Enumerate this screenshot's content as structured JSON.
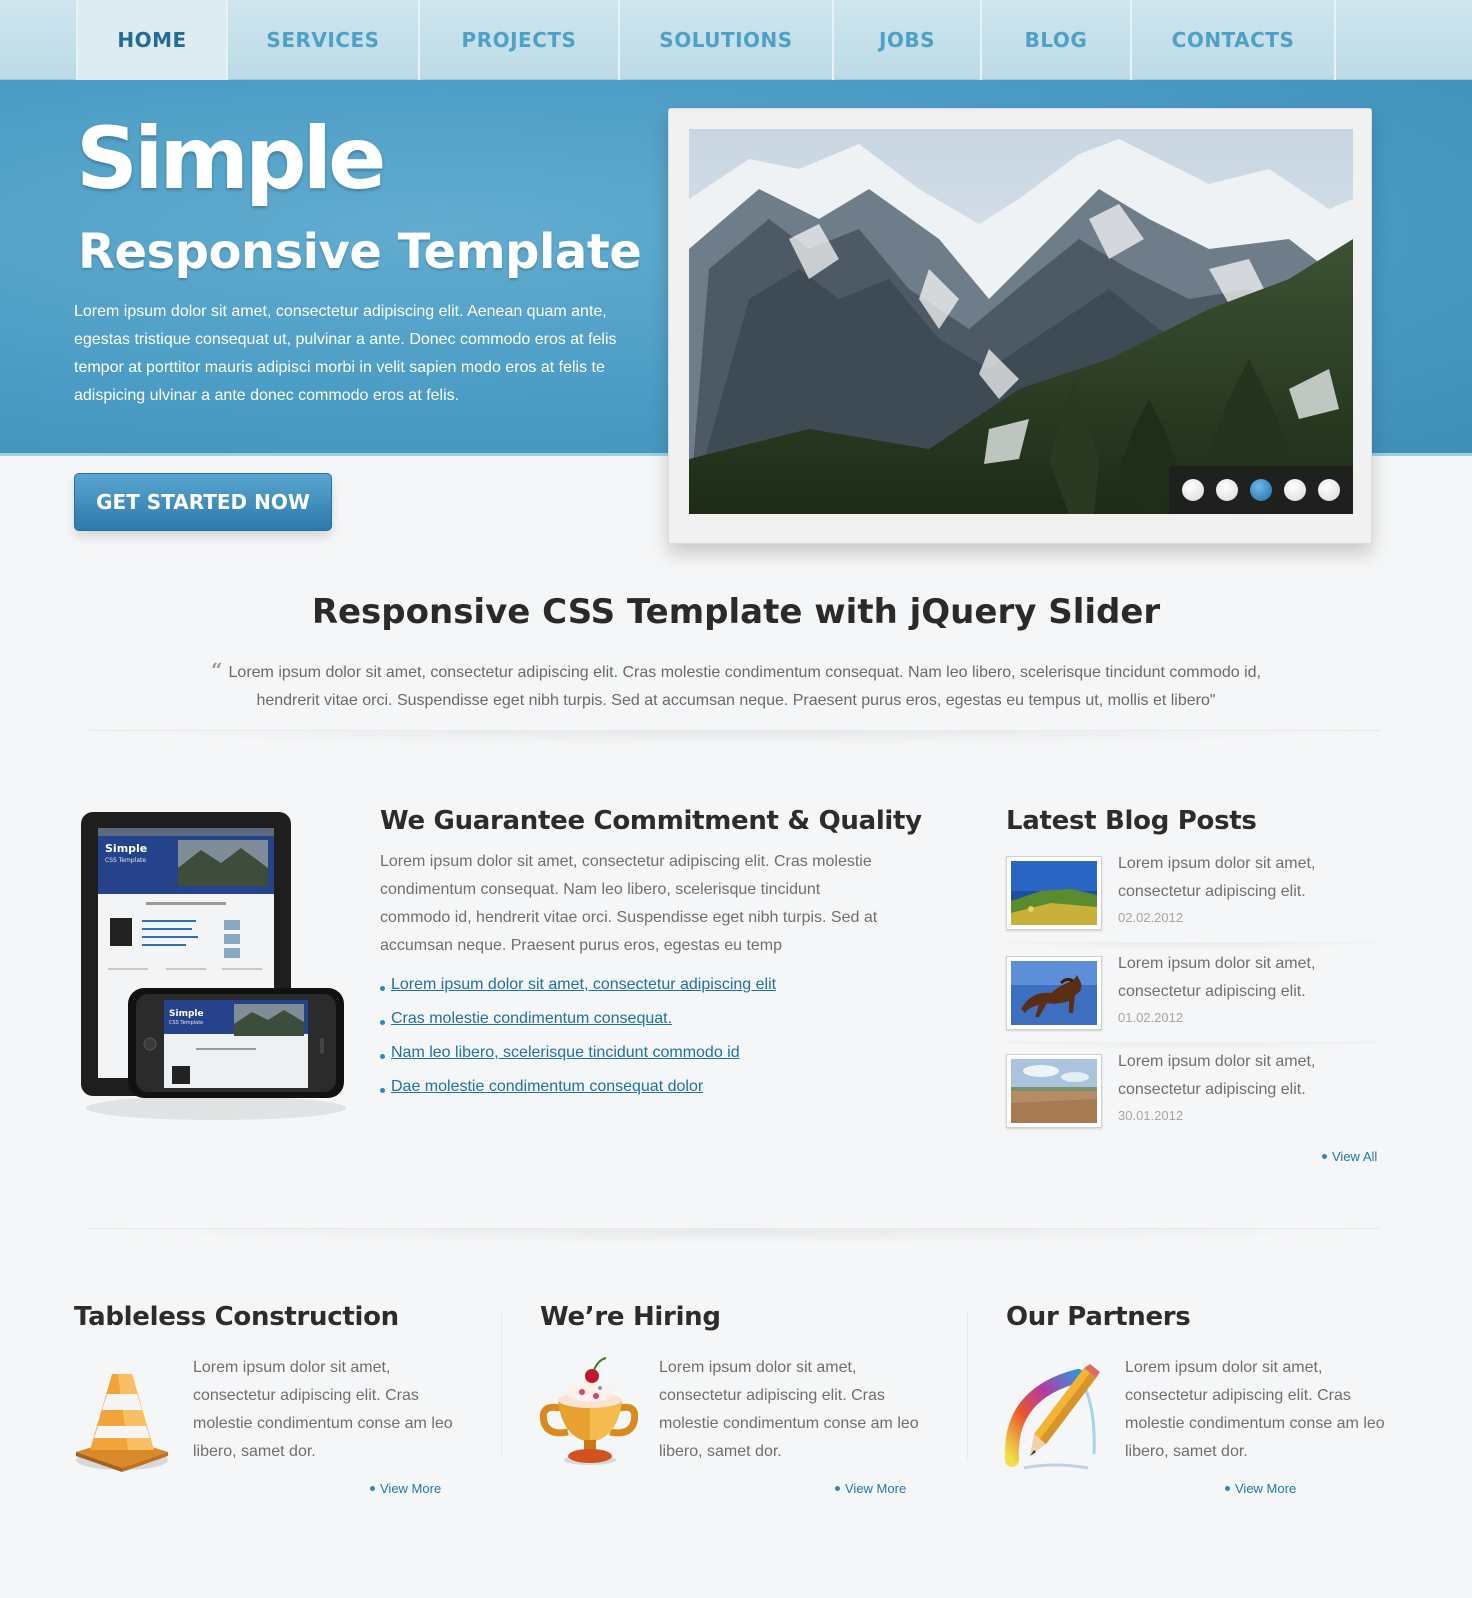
{
  "nav": {
    "items": [
      {
        "label": "HOME",
        "active": true
      },
      {
        "label": "SERVICES",
        "active": false
      },
      {
        "label": "PROJECTS",
        "active": false
      },
      {
        "label": "SOLUTIONS",
        "active": false
      },
      {
        "label": "JOBS",
        "active": false
      },
      {
        "label": "BLOG",
        "active": false
      },
      {
        "label": "CONTACTS",
        "active": false
      }
    ]
  },
  "hero": {
    "title": "Simple",
    "subtitle": "Responsive Template",
    "text": "Lorem ipsum dolor sit amet, consectetur adipiscing elit. Aenean quam ante, egestas tristique consequat ut, pulvinar a ante. Donec commodo eros at felis tempor at porttitor mauris adipisci morbi in velit sapien modo eros at felis te adispicing ulvinar a ante donec commodo eros at felis.",
    "cta_label": "GET STARTED NOW",
    "accent_color": "#4a9cc4"
  },
  "slider": {
    "total_slides": 5,
    "active_slide": 3
  },
  "intro": {
    "title": "Responsive CSS Template with jQuery Slider",
    "quote_mark": "“",
    "quote": "Lorem ipsum dolor sit amet, consectetur adipiscing elit. Cras molestie condimentum consequat. Nam leo libero, scelerisque tincidunt commodo id, hendrerit vitae orci. Suspendisse eget nibh turpis. Sed at accumsan neque. Praesent purus eros, egestas eu tempus ut, mollis et libero\""
  },
  "guarantee": {
    "title": "We Guarantee Commitment & Quality",
    "text": "Lorem ipsum dolor sit amet, consectetur adipiscing elit. Cras molestie condimentum consequat. Nam leo libero, scelerisque tincidunt commodo id, hendrerit vitae orci. Suspendisse eget nibh turpis. Sed at accumsan neque. Praesent purus eros, egestas eu temp",
    "links": [
      "Lorem ipsum dolor sit amet, consectetur adipiscing elit",
      "Cras molestie condimentum consequat.",
      "Nam leo libero, scelerisque tincidunt commodo id",
      "Dae molestie condimentum consequat dolor"
    ]
  },
  "devices": {
    "tablet_title": "Simple",
    "tablet_subtitle": "CSS Template",
    "phone_title": "Simple",
    "phone_subtitle": "CSS Template"
  },
  "blog": {
    "title": "Latest Blog Posts",
    "posts": [
      {
        "text": "Lorem ipsum dolor sit amet, consectetur adipiscing elit.",
        "date": "02.02.2012",
        "image": "landscape-thumbnail"
      },
      {
        "text": "Lorem ipsum dolor sit amet, consectetur adipiscing elit.",
        "date": "01.02.2012",
        "image": "horse-thumbnail"
      },
      {
        "text": "Lorem ipsum dolor sit amet, consectetur adipiscing elit.",
        "date": "30.01.2012",
        "image": "field-thumbnail"
      }
    ],
    "view_all": "View All"
  },
  "columns": [
    {
      "title": "Tableless Construction",
      "text": "Lorem ipsum dolor sit amet, consectetur adipiscing elit. Cras molestie condimentum conse am leo libero, samet dor.",
      "link": "View More",
      "icon": "traffic-cone-icon"
    },
    {
      "title": "We’re Hiring",
      "text": "Lorem ipsum dolor sit amet, consectetur adipiscing elit. Cras molestie condimentum conse am leo libero, samet dor.",
      "link": "View More",
      "icon": "trophy-icon"
    },
    {
      "title": "Our Partners",
      "text": "Lorem ipsum dolor sit amet, consectetur adipiscing elit. Cras molestie condimentum conse am leo libero, samet dor.",
      "link": "View More",
      "icon": "pencil-icon"
    }
  ]
}
